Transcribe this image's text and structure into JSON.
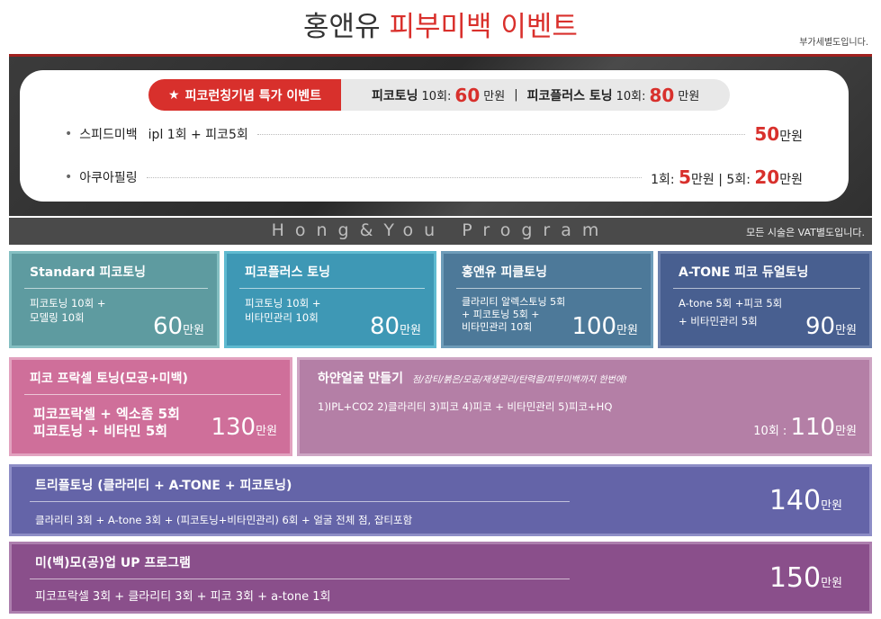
{
  "header": {
    "title_main": "홍앤유 ",
    "title_accent": "피부미백 이벤트",
    "vat_note": "부가세별도입니다."
  },
  "event": {
    "tag_star": "★",
    "tag_label": "피코런칭기념 특가 이벤트",
    "strip": {
      "item1_label": "피코토닝",
      "item1_count": "10회:",
      "item1_price": "60",
      "item1_unit": "만원",
      "separator": "|",
      "item2_label": "피코플러스 토닝",
      "item2_count": "10회:",
      "item2_price": "80",
      "item2_unit": "만원"
    },
    "rows": [
      {
        "bullet": "•",
        "label": "스피드미백",
        "detail": "ipl 1회 + 피코5회",
        "price_prefix": "",
        "price": "50",
        "unit": "만원",
        "price2_prefix": "",
        "price2": "",
        "unit2": ""
      },
      {
        "bullet": "•",
        "label": "아쿠아필링",
        "detail": "",
        "price_prefix": "1회:",
        "price": "5",
        "unit": "만원 |",
        "price2_prefix": "5회:",
        "price2": "20",
        "unit2": "만원"
      }
    ]
  },
  "program": {
    "title": "Hong&You Program",
    "vat_note": "모든 시술은 VAT별도입니다."
  },
  "packages": {
    "standard": {
      "title": "Standard 피코토닝",
      "desc1": "피코토닝 10회 +",
      "desc2": "모델링 10회",
      "price": "60",
      "unit": "만원"
    },
    "plus": {
      "title": "피코플러스 토닝",
      "desc1": "피코토닝 10회 +",
      "desc2": "비타민관리 10회",
      "price": "80",
      "unit": "만원"
    },
    "peel": {
      "title": "홍앤유 피클토닝",
      "desc1": "클라리티 알렉스토닝 5회",
      "desc2": "+ 피코토닝 5회 +",
      "desc3": "비타민관리 10회",
      "price": "100",
      "unit": "만원"
    },
    "atone": {
      "title": "A-TONE 피코 듀얼토닝",
      "desc1": "A-tone 5회 +피코 5회",
      "desc2": "+ 비타민관리 5회",
      "price": "90",
      "unit": "만원"
    },
    "fractional": {
      "title": "피코 프락셀 토닝(모공+미백)",
      "desc1": "피코프락셀 + 엑소좀 5회",
      "desc2": "피코토닝 + 비타민 5회",
      "price": "130",
      "unit": "만원"
    },
    "white_face": {
      "title": "하얀얼굴 만들기",
      "note": "점/잡티/붉은/모공/재생관리/탄력을/피부미백까지 한번에!",
      "desc1": "1)IPL+CO2  2)클라리티  3)피코  4)피코 + 비타민관리  5)피코+HQ",
      "price_prefix": "10회 :",
      "price": "110",
      "unit": "만원"
    },
    "triple": {
      "title": "트리플토닝 (클라리티 + A-TONE + 피코토닝)",
      "desc1": "클라리티 3회 + A-tone 3회 + (피코토닝+비타민관리) 6회 + 얼굴 전체 점, 잡티포함",
      "price": "140",
      "unit": "만원"
    },
    "mibaek": {
      "title": "미(백)모(공)업 UP 프로그램",
      "desc1": "피코프락셀 3회 + 클라리티 3회 + 피코 3회 + a-tone 1회",
      "price": "150",
      "unit": "만원"
    }
  }
}
